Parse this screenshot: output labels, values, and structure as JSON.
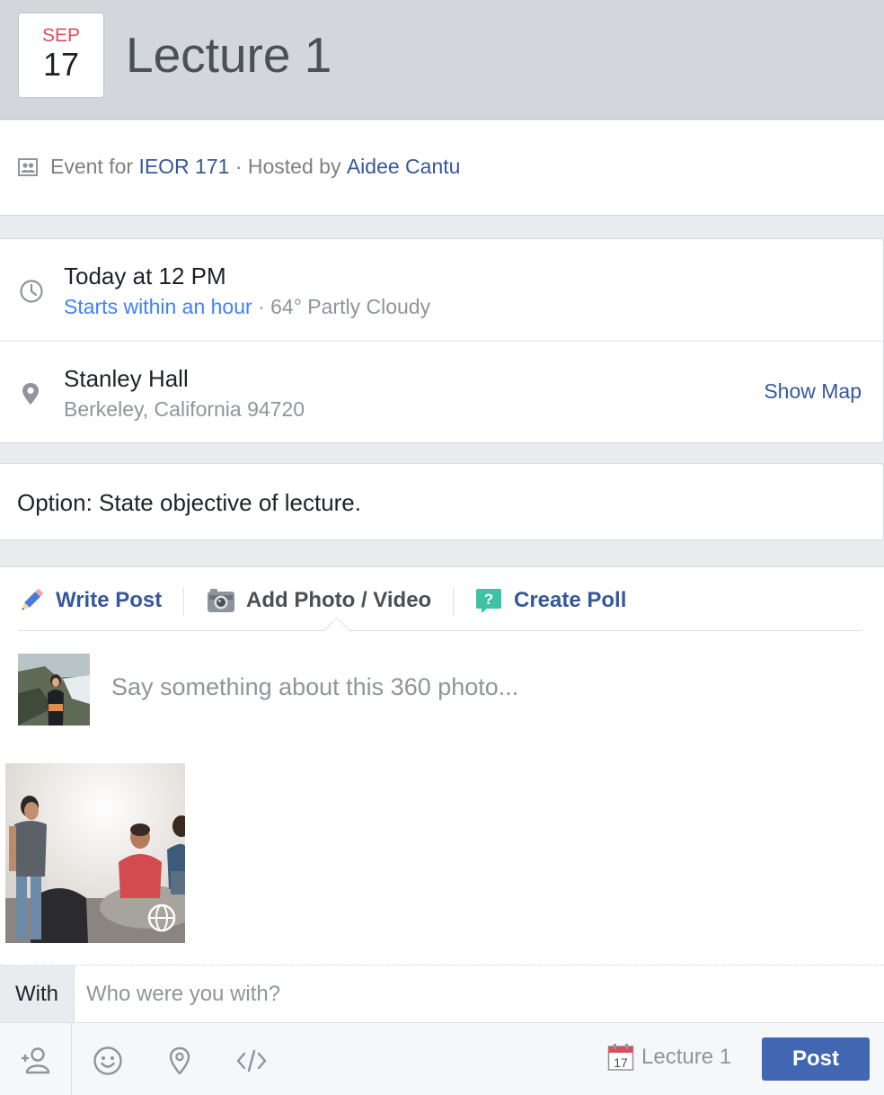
{
  "header": {
    "date_month": "SEP",
    "date_day": "17",
    "title": "Lecture 1"
  },
  "host": {
    "prefix": "Event for",
    "group": "IEOR 171",
    "separator": "·",
    "hosted_by": "Hosted by",
    "host_name": "Aidee Cantu"
  },
  "time": {
    "main": "Today at 12 PM",
    "status": "Starts within an hour",
    "separator": "·",
    "weather": "64° Partly Cloudy"
  },
  "location": {
    "name": "Stanley Hall",
    "address": "Berkeley, California 94720",
    "show_map": "Show Map"
  },
  "description": "Option: State objective of lecture.",
  "composer": {
    "tabs": {
      "write": "Write Post",
      "photo": "Add Photo / Video",
      "poll": "Create Poll"
    },
    "placeholder": "Say something about this 360 photo...",
    "with_label": "With",
    "with_placeholder": "Who were you with?",
    "event_tag_day": "17",
    "event_tag_label": "Lecture 1",
    "post_label": "Post"
  },
  "icons": [
    "group-icon",
    "clock-icon",
    "location-pin-icon",
    "pencil-icon",
    "camera-icon",
    "poll-icon",
    "tag-friend-icon",
    "smiley-icon",
    "checkin-icon",
    "embed-code-icon",
    "calendar-icon",
    "360-globe-icon"
  ],
  "colors": {
    "header_bg": "#d3d6db",
    "link": "#365899",
    "link_bright": "#4080ff",
    "month_red": "#e04c5d",
    "post_button": "#4267b2",
    "poll_green": "#3fc1a5"
  }
}
